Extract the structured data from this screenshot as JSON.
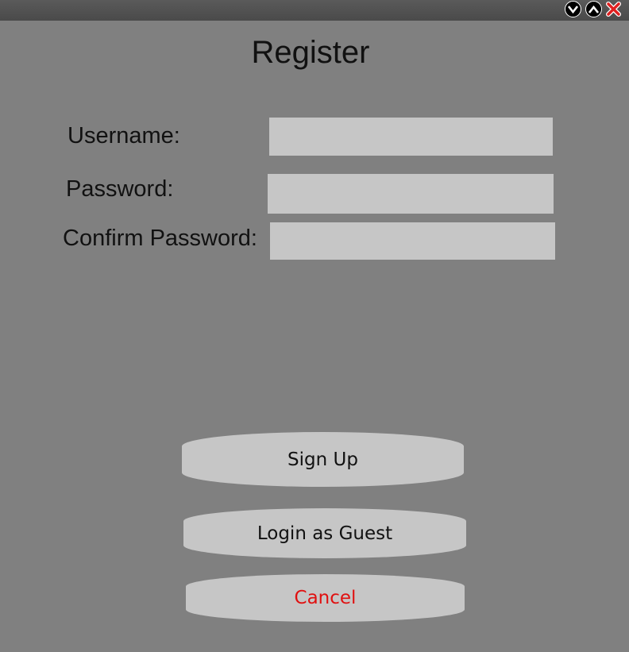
{
  "window": {
    "controls": [
      {
        "name": "minimize",
        "icon": "chevron-down-icon"
      },
      {
        "name": "maximize",
        "icon": "chevron-up-icon"
      },
      {
        "name": "close",
        "icon": "close-icon"
      }
    ]
  },
  "form": {
    "title": "Register",
    "username_label": "Username:",
    "username_value": "",
    "password_label": "Password:",
    "password_value": "",
    "confirm_label": "Confirm Password:",
    "confirm_value": ""
  },
  "actions": {
    "signup_label": "Sign Up",
    "guest_label": "Login as Guest",
    "cancel_label": "Cancel"
  },
  "colors": {
    "background": "#808080",
    "field": "#c6c6c6",
    "cancel_text": "#e01010"
  }
}
